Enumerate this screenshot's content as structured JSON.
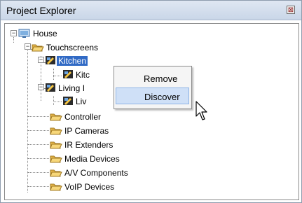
{
  "panel": {
    "title": "Project Explorer",
    "close_glyph": "⊠"
  },
  "tree": {
    "root": "House",
    "touchscreens": "Touchscreens",
    "kitchen": "Kitchen",
    "kitchen_child": "Kitc",
    "living": "Living I",
    "living_child": "Liv",
    "controller": "Controller",
    "ip_cameras": "IP Cameras",
    "ir_extenders": "IR Extenders",
    "media_devices": "Media Devices",
    "av_components": "A/V Components",
    "voip_devices": "VoIP Devices"
  },
  "context_menu": {
    "remove": "Remove",
    "discover": "Discover"
  },
  "icons": {
    "folder": "folder-icon",
    "house": "house-icon",
    "touchscreen": "touchscreen-icon",
    "cursor": "mouse-cursor-icon"
  },
  "colors": {
    "selection": "#316ac5",
    "menu_hover": "#cfe0f7",
    "folder": "#f2c94c"
  }
}
